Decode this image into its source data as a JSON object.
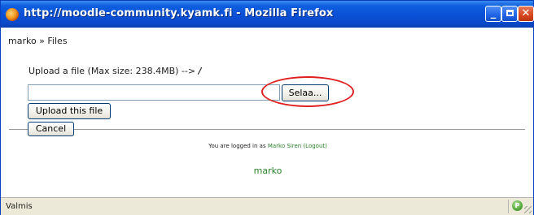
{
  "window": {
    "title": "http://moodle-community.kyamk.fi - Mozilla Firefox",
    "app_icon": "firefox-icon",
    "minimize_glyph": "_",
    "close_glyph": "✕"
  },
  "breadcrumb": {
    "text": "marko » Files"
  },
  "upload": {
    "info_text": "Upload a file (Max size: 238.4MB) -->",
    "path": "/",
    "file_value": "",
    "browse_label": "Selaa...",
    "upload_label": "Upload this file",
    "cancel_label": "Cancel",
    "highlight_color": "#e02020"
  },
  "footer": {
    "logged_in_prefix": "You are logged in as",
    "user_name": "Marko Siren",
    "logout_label": "(Logout)",
    "home_link": "marko",
    "link_color": "#2a7f2a"
  },
  "statusbar": {
    "text": "Valmis",
    "icon": "page-status-icon",
    "icon_glyph": "P"
  }
}
